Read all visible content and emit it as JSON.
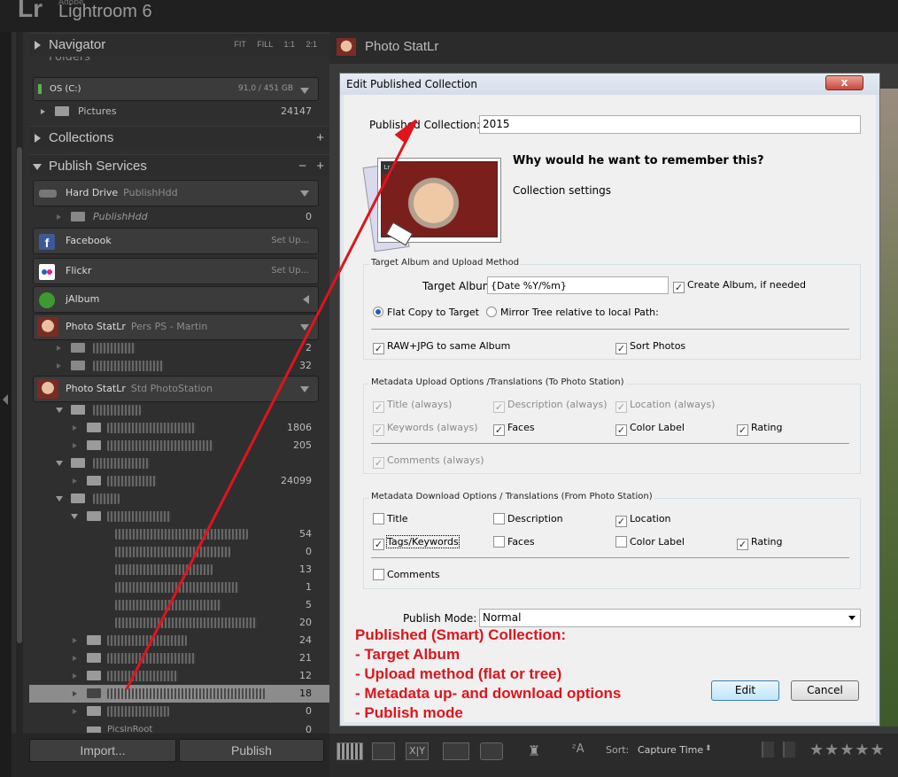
{
  "app": {
    "logo": "Lr",
    "adobe": "Adobe",
    "name": "Lightroom 6"
  },
  "left_panel": {
    "navigator": {
      "label": "Navigator",
      "tools": [
        "FIT",
        "FILL",
        "1:1",
        "2:1"
      ]
    },
    "folders_partial": "Folders",
    "volume": {
      "name": "OS (C:)",
      "space": "91,0 / 451 GB"
    },
    "pictures": {
      "name": "Pictures",
      "count": "24147"
    },
    "collections": {
      "label": "Collections"
    },
    "publish_services": {
      "label": "Publish Services"
    },
    "services": [
      {
        "name": "Hard Drive",
        "sub": "PublishHdd",
        "end": ""
      },
      {
        "name": "Facebook",
        "sub": "",
        "end": "Set Up..."
      },
      {
        "name": "Flickr",
        "sub": "",
        "end": "Set Up..."
      },
      {
        "name": "jAlbum",
        "sub": "",
        "end": ""
      },
      {
        "name": "Photo StatLr",
        "sub": "Pers PS - Martin",
        "end": ""
      },
      {
        "name": "Photo StatLr",
        "sub": "Std PhotoStation",
        "end": ""
      }
    ],
    "publish_hdd_child": {
      "name": "PublishHdd",
      "count": "0"
    },
    "pers_counts": [
      "2",
      "32"
    ],
    "std_counts": [
      "1806",
      "205",
      "24099",
      "54",
      "0",
      "13",
      "1",
      "5",
      "20",
      "24",
      "21",
      "12",
      "18",
      "0"
    ],
    "last_row": "PicsInRoot",
    "last_count": "0",
    "import_label": "Import...",
    "publish_label": "Publish"
  },
  "center": {
    "title": "Photo StatLr"
  },
  "toolbar": {
    "sort_label": "Sort:",
    "sort_value": "Capture Time",
    "stars": "★★★★★"
  },
  "dialog": {
    "title": "Edit Published Collection",
    "close": "x",
    "collection_label": "Published Collection:",
    "collection_value": "2015",
    "heading": "Why would he want to remember this?",
    "subheading": "Collection settings",
    "group1": {
      "title": "Target Album and Upload Method",
      "target_label": "Target Album:",
      "target_value": "{Date %Y/%m}",
      "create_album": "Create Album, if needed",
      "flat_copy": "Flat Copy to Target",
      "mirror_tree": "Mirror Tree relative to local Path:",
      "raw_jpg": "RAW+JPG to same Album",
      "sort_photos": "Sort Photos"
    },
    "group2": {
      "title": "Metadata Upload Options /Translations (To Photo Station)",
      "title_always": "Title (always)",
      "desc_always": "Description (always)",
      "loc_always": "Location (always)",
      "kw_always": "Keywords (always)",
      "faces": "Faces",
      "color_label": "Color Label",
      "rating": "Rating",
      "comments_always": "Comments (always)"
    },
    "group3": {
      "title": "Metadata Download Options / Translations  (From Photo Station)",
      "title_cb": "Title",
      "description": "Description",
      "location": "Location",
      "tags": "Tags/Keywords",
      "faces": "Faces",
      "color_label": "Color Label",
      "rating": "Rating",
      "comments": "Comments"
    },
    "publish_mode_label": "Publish Mode:",
    "publish_mode_value": "Normal",
    "edit_btn": "Edit",
    "cancel_btn": "Cancel"
  },
  "annotation": {
    "lines": [
      "Published (Smart) Collection:",
      "- Target Album",
      "- Upload method (flat or tree)",
      "- Metadata up- and download options",
      "- Publish mode"
    ]
  },
  "colors": {
    "annotation": "#e0141c",
    "panel": "#2f2f2f",
    "dialog": "#f0f0f0"
  }
}
